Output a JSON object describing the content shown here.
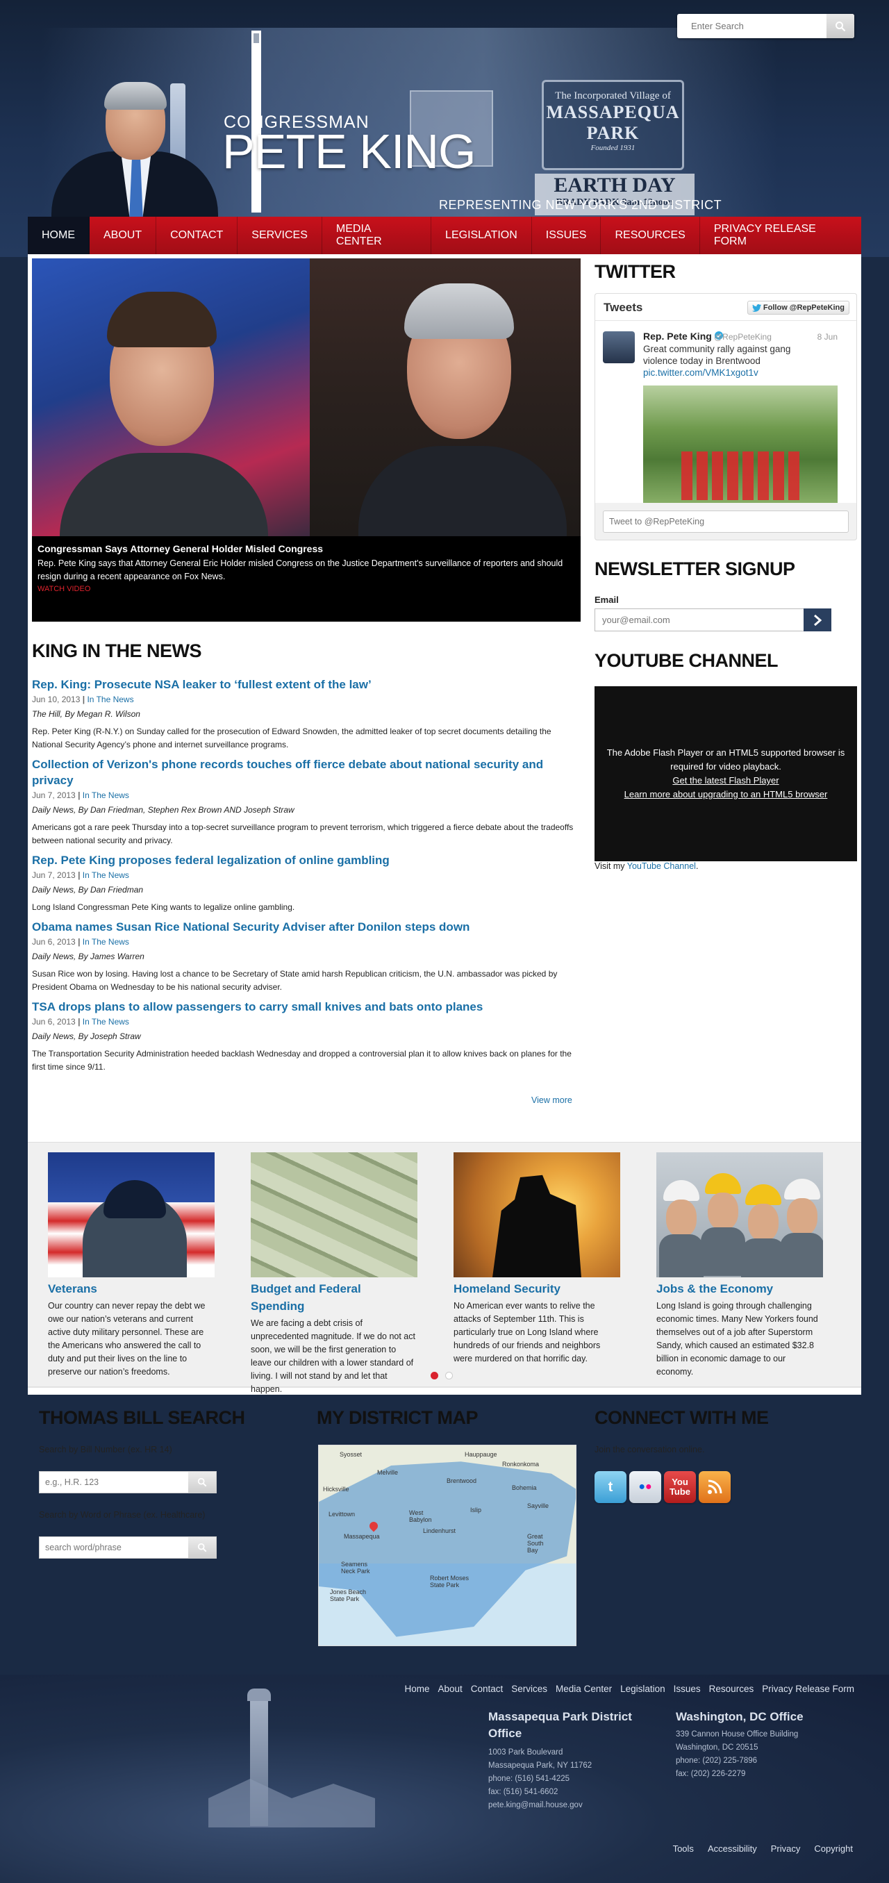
{
  "header": {
    "search_placeholder": "Enter Search",
    "title_small": "CONGRESSMAN",
    "title_name": "PETE KING",
    "tagline": "REPRESENTING NEW YORK'S 2ND DISTRICT",
    "bg_sign": {
      "line1": "The Incorporated Village of",
      "line2": "MASSAPEQUA PARK",
      "line3": "Founded 1931",
      "earth_day": "EARTH DAY",
      "earth_day_sub": "BRADY PARK 9am-12noon"
    }
  },
  "nav": {
    "items": [
      "HOME",
      "ABOUT",
      "CONTACT",
      "SERVICES",
      "MEDIA CENTER",
      "LEGISLATION",
      "ISSUES",
      "RESOURCES",
      "PRIVACY RELEASE FORM"
    ],
    "active": "HOME"
  },
  "hero": {
    "title": "Congressman Says Attorney General Holder Misled Congress",
    "text": "Rep. Pete King says that Attorney General Eric Holder misled Congress on the Justice Department's surveillance of reporters and should resign during a recent appearance on Fox News.",
    "link": "WATCH VIDEO"
  },
  "news": {
    "title": "KING IN THE NEWS",
    "items": [
      {
        "title": "Rep. King: Prosecute NSA leaker to ‘fullest extent of the law’",
        "date": "Jun 10, 2013",
        "category": "In The News",
        "source": "The Hill, By Megan R. Wilson",
        "body": "Rep. Peter King (R-N.Y.) on Sunday called for the prosecution of Edward Snowden, the admitted leaker of top secret documents detailing the National Security Agency’s phone and internet surveillance programs."
      },
      {
        "title": "Collection of Verizon's phone records touches off fierce debate about national security and privacy",
        "date": "Jun 7, 2013",
        "category": "In The News",
        "source": "Daily News, By Dan Friedman, Stephen Rex Brown AND Joseph Straw",
        "body": "Americans got a rare peek Thursday into a top-secret surveillance program to prevent terrorism, which triggered a fierce debate about the tradeoffs between national security and privacy."
      },
      {
        "title": "Rep. Pete King proposes federal legalization of online gambling",
        "date": "Jun 7, 2013",
        "category": "In The News",
        "source": "Daily News, By Dan Friedman",
        "body": "Long Island Congressman Pete King wants to legalize online gambling."
      },
      {
        "title": "Obama names Susan Rice National Security Adviser after Donilon steps down",
        "date": "Jun 6, 2013",
        "category": "In The News",
        "source": "Daily News, By James Warren",
        "body": "Susan Rice won by losing. Having lost a chance to be Secretary of State amid harsh Republican criticism, the U.N. ambassador was picked by President Obama on Wednesday to be his national security adviser."
      },
      {
        "title": "TSA drops plans to allow passengers to carry small knives and bats onto planes",
        "date": "Jun 6, 2013",
        "category": "In The News",
        "source": "Daily News, By Joseph Straw",
        "body": "The Transportation Security Administration heeded backlash Wednesday and dropped a controversial plan it to allow knives back on planes for the first time since 9/11."
      }
    ],
    "view_more": "View more"
  },
  "twitter": {
    "title": "TWITTER",
    "widget_label": "Tweets",
    "follow": "Follow @RepPeteKing",
    "name": "Rep. Pete King",
    "handle": "@RepPeteKing",
    "date": "8 Jun",
    "text": "Great community rally against gang violence today in Brentwood",
    "link": "pic.twitter.com/VMK1xgot1v",
    "input_placeholder": "Tweet to @RepPeteKing"
  },
  "newsletter": {
    "title": "NEWSLETTER SIGNUP",
    "email_label": "Email",
    "email_placeholder": "your@email.com"
  },
  "youtube": {
    "title": "YOUTUBE CHANNEL",
    "msg": "The Adobe Flash Player or an HTML5 supported browser is required for video playback.",
    "link1": "Get the latest Flash Player",
    "link2": "Learn more about upgrading to an HTML5 browser",
    "visit_prefix": "Visit my",
    "visit_link": "YouTube Channel",
    "visit_suffix": "."
  },
  "features": [
    {
      "title": "Veterans",
      "text": "Our country can never repay the debt we owe our nation’s veterans and current active duty military personnel. These are the Americans who answered the call to duty and put their lives on the line to preserve our nation’s freedoms."
    },
    {
      "title": "Budget and Federal Spending",
      "text": "We are facing a debt crisis of unprecedented magnitude. If we do not act soon, we will be the first generation to leave our children with a lower standard of living. I will not stand by and let that happen."
    },
    {
      "title": "Homeland Security",
      "text": "No American ever wants to relive the attacks of September 11th. This is particularly true on Long Island where hundreds of our friends and neighbors were murdered on that horrific day."
    },
    {
      "title": "Jobs & the Economy",
      "text": "Long Island is going through challenging economic times. Many New Yorkers found themselves out of a job after Superstorm Sandy, which caused an estimated $32.8 billion in economic damage to our economy."
    }
  ],
  "bill": {
    "title": "THOMAS BILL SEARCH",
    "label1": "Search by Bill Number (ex. HR 14)",
    "placeholder1": "e.g., H.R. 123",
    "label2": "Search by Word or Phrase (ex. Healthcare)",
    "placeholder2": "search word/phrase"
  },
  "map": {
    "title": "MY DISTRICT MAP",
    "labels": [
      "Syosset",
      "Melville",
      "Hauppauge",
      "Ronkonkoma",
      "Brentwood",
      "Bohemia",
      "Hicksville",
      "Sayville",
      "Levittown",
      "West Babylon",
      "Islip",
      "Massapequa",
      "Lindenhurst",
      "Great South Bay",
      "Seamens Neck Park",
      "Robert Moses State Park",
      "Jones Beach State Park"
    ]
  },
  "connect": {
    "title": "CONNECT WITH ME",
    "text": "Join the conversation online.",
    "icons": [
      "twitter-icon",
      "flickr-icon",
      "youtube-icon",
      "rss-icon"
    ]
  },
  "footer": {
    "nav": [
      "Home",
      "About",
      "Contact",
      "Services",
      "Media Center",
      "Legislation",
      "Issues",
      "Resources",
      "Privacy Release Form"
    ],
    "office1": {
      "title": "Massapequa Park District Office",
      "lines": [
        "1003 Park Boulevard",
        "Massapequa Park, NY 11762",
        "phone: (516) 541-4225",
        "fax: (516) 541-6602",
        "pete.king@mail.house.gov"
      ]
    },
    "office2": {
      "title": "Washington, DC Office",
      "lines": [
        "339 Cannon House Office Building",
        "Washington, DC 20515",
        "phone: (202) 225-7896",
        "fax: (202) 226-2279"
      ]
    },
    "tools": [
      "Tools",
      "Accessibility",
      "Privacy",
      "Copyright"
    ]
  },
  "colors": {
    "nav_red": "#c8101b",
    "link_blue": "#1a6fa6",
    "header_navy": "#1d3152",
    "dot_active": "#d9232e"
  }
}
